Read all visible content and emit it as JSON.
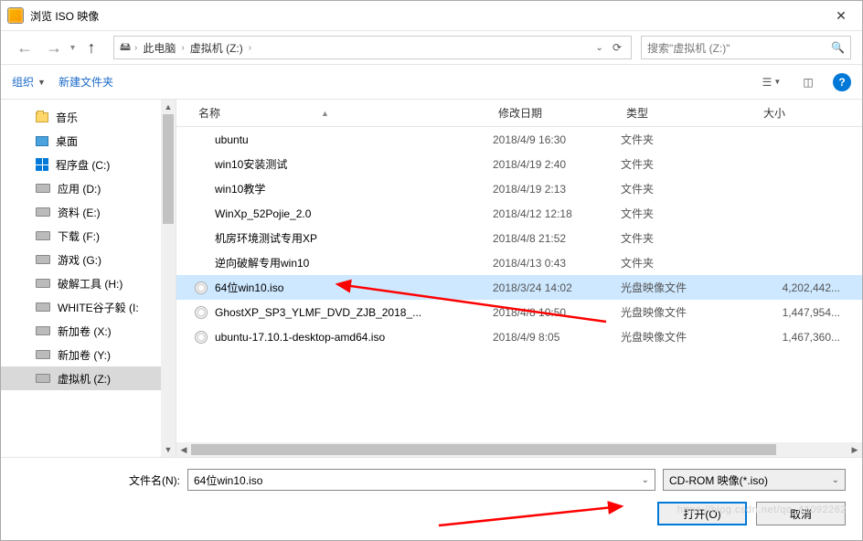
{
  "title": "浏览 ISO 映像",
  "breadcrumb": {
    "root": "此电脑",
    "folder": "虚拟机 (Z:)"
  },
  "search_placeholder": "搜索\"虚拟机 (Z:)\"",
  "toolbar": {
    "organize": "组织",
    "newfolder": "新建文件夹"
  },
  "columns": {
    "name": "名称",
    "date": "修改日期",
    "type": "类型",
    "size": "大小"
  },
  "sidebar": [
    {
      "icon": "fld",
      "label": "音乐"
    },
    {
      "icon": "desk",
      "label": "桌面"
    },
    {
      "icon": "win",
      "label": "程序盘 (C:)"
    },
    {
      "icon": "drv",
      "label": "应用 (D:)"
    },
    {
      "icon": "drv",
      "label": "资料 (E:)"
    },
    {
      "icon": "drv",
      "label": "下载 (F:)"
    },
    {
      "icon": "drv",
      "label": "游戏 (G:)"
    },
    {
      "icon": "drv",
      "label": "破解工具 (H:)"
    },
    {
      "icon": "drv",
      "label": "WHITE谷子毅 (I:"
    },
    {
      "icon": "drv",
      "label": "新加卷 (X:)"
    },
    {
      "icon": "drv",
      "label": "新加卷 (Y:)"
    },
    {
      "icon": "drv",
      "label": "虚拟机 (Z:)",
      "selected": true
    }
  ],
  "files": [
    {
      "icon": "fld",
      "name": "ubuntu",
      "date": "2018/4/9 16:30",
      "type": "文件夹",
      "size": ""
    },
    {
      "icon": "fld",
      "name": "win10安装测试",
      "date": "2018/4/19 2:40",
      "type": "文件夹",
      "size": ""
    },
    {
      "icon": "fld",
      "name": "win10教学",
      "date": "2018/4/19 2:13",
      "type": "文件夹",
      "size": ""
    },
    {
      "icon": "fld",
      "name": "WinXp_52Pojie_2.0",
      "date": "2018/4/12 12:18",
      "type": "文件夹",
      "size": ""
    },
    {
      "icon": "fld",
      "name": "机房环境测试专用XP",
      "date": "2018/4/8 21:52",
      "type": "文件夹",
      "size": ""
    },
    {
      "icon": "fld",
      "name": "逆向破解专用win10",
      "date": "2018/4/13 0:43",
      "type": "文件夹",
      "size": ""
    },
    {
      "icon": "iso",
      "name": "64位win10.iso",
      "date": "2018/3/24 14:02",
      "type": "光盘映像文件",
      "size": "4,202,442...",
      "selected": true
    },
    {
      "icon": "iso",
      "name": "GhostXP_SP3_YLMF_DVD_ZJB_2018_...",
      "date": "2018/4/8 10:50",
      "type": "光盘映像文件",
      "size": "1,447,954..."
    },
    {
      "icon": "iso",
      "name": "ubuntu-17.10.1-desktop-amd64.iso",
      "date": "2018/4/9 8:05",
      "type": "光盘映像文件",
      "size": "1,467,360..."
    }
  ],
  "filename_label": "文件名(N):",
  "filename_value": "64位win10.iso",
  "filter_value": "CD-ROM 映像(*.iso)",
  "open_btn": "打开(O)",
  "cancel_btn": "取消",
  "watermark": "https://blog.csdn.net/qq_41092262"
}
